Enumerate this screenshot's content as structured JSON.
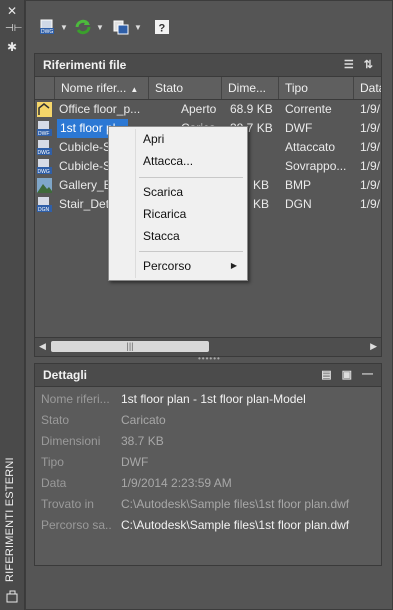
{
  "palette": {
    "title": "RIFERIMENTI ESTERNI"
  },
  "toolbar": {
    "attach_icon": "attach-dwg-icon",
    "refresh_icon": "refresh-icon",
    "change_path_icon": "change-path-icon",
    "help_icon": "help-icon"
  },
  "file_refs": {
    "title": "Riferimenti file",
    "columns": [
      "Nome rifer...",
      "Stato",
      "Dime...",
      "Tipo",
      "Data"
    ],
    "rows": [
      {
        "name": "Office floor_p...",
        "status": "Aperto",
        "size": "68.9 KB",
        "type": "Corrente",
        "date": "1/9/",
        "icon": "dwg-file-icon"
      },
      {
        "name": "1st floor pl...",
        "status": "Carica...",
        "size": "38.7 KB",
        "type": "DWF",
        "date": "1/9/",
        "icon": "dwf-file-icon"
      },
      {
        "name": "Cubicle-S...",
        "status": "",
        "size": "",
        "type": "Attaccato",
        "date": "1/9/",
        "icon": "dwg-file-icon"
      },
      {
        "name": "Cubicle-S...",
        "status": "",
        "size": "",
        "type": "Sovrappo...",
        "date": "1/9/",
        "icon": "dwg-file-icon"
      },
      {
        "name": "Gallery_Ex...",
        "status": "",
        "size": "KB",
        "type": "BMP",
        "date": "1/9/",
        "icon": "image-file-icon"
      },
      {
        "name": "Stair_Deta...",
        "status": "",
        "size": "KB",
        "type": "DGN",
        "date": "1/9/",
        "icon": "dgn-file-icon"
      }
    ],
    "scroll_thumb": "|||"
  },
  "context_menu": {
    "items": [
      "Apri",
      "Attacca...",
      "Scarica",
      "Ricarica",
      "Stacca",
      "Percorso"
    ]
  },
  "details": {
    "title": "Dettagli",
    "rows": [
      {
        "label": "Nome riferi...",
        "value": "1st floor plan - 1st floor plan-Model"
      },
      {
        "label": "Stato",
        "value": "Caricato"
      },
      {
        "label": "Dimensioni",
        "value": "38.7 KB"
      },
      {
        "label": "Tipo",
        "value": "DWF"
      },
      {
        "label": "Data",
        "value": "1/9/2014 2:23:59 AM"
      },
      {
        "label": "Trovato in",
        "value": "C:\\Autodesk\\Sample files\\1st floor plan.dwf"
      },
      {
        "label": "Percorso sa...",
        "value": "C:\\Autodesk\\Sample files\\1st floor plan.dwf"
      }
    ]
  }
}
